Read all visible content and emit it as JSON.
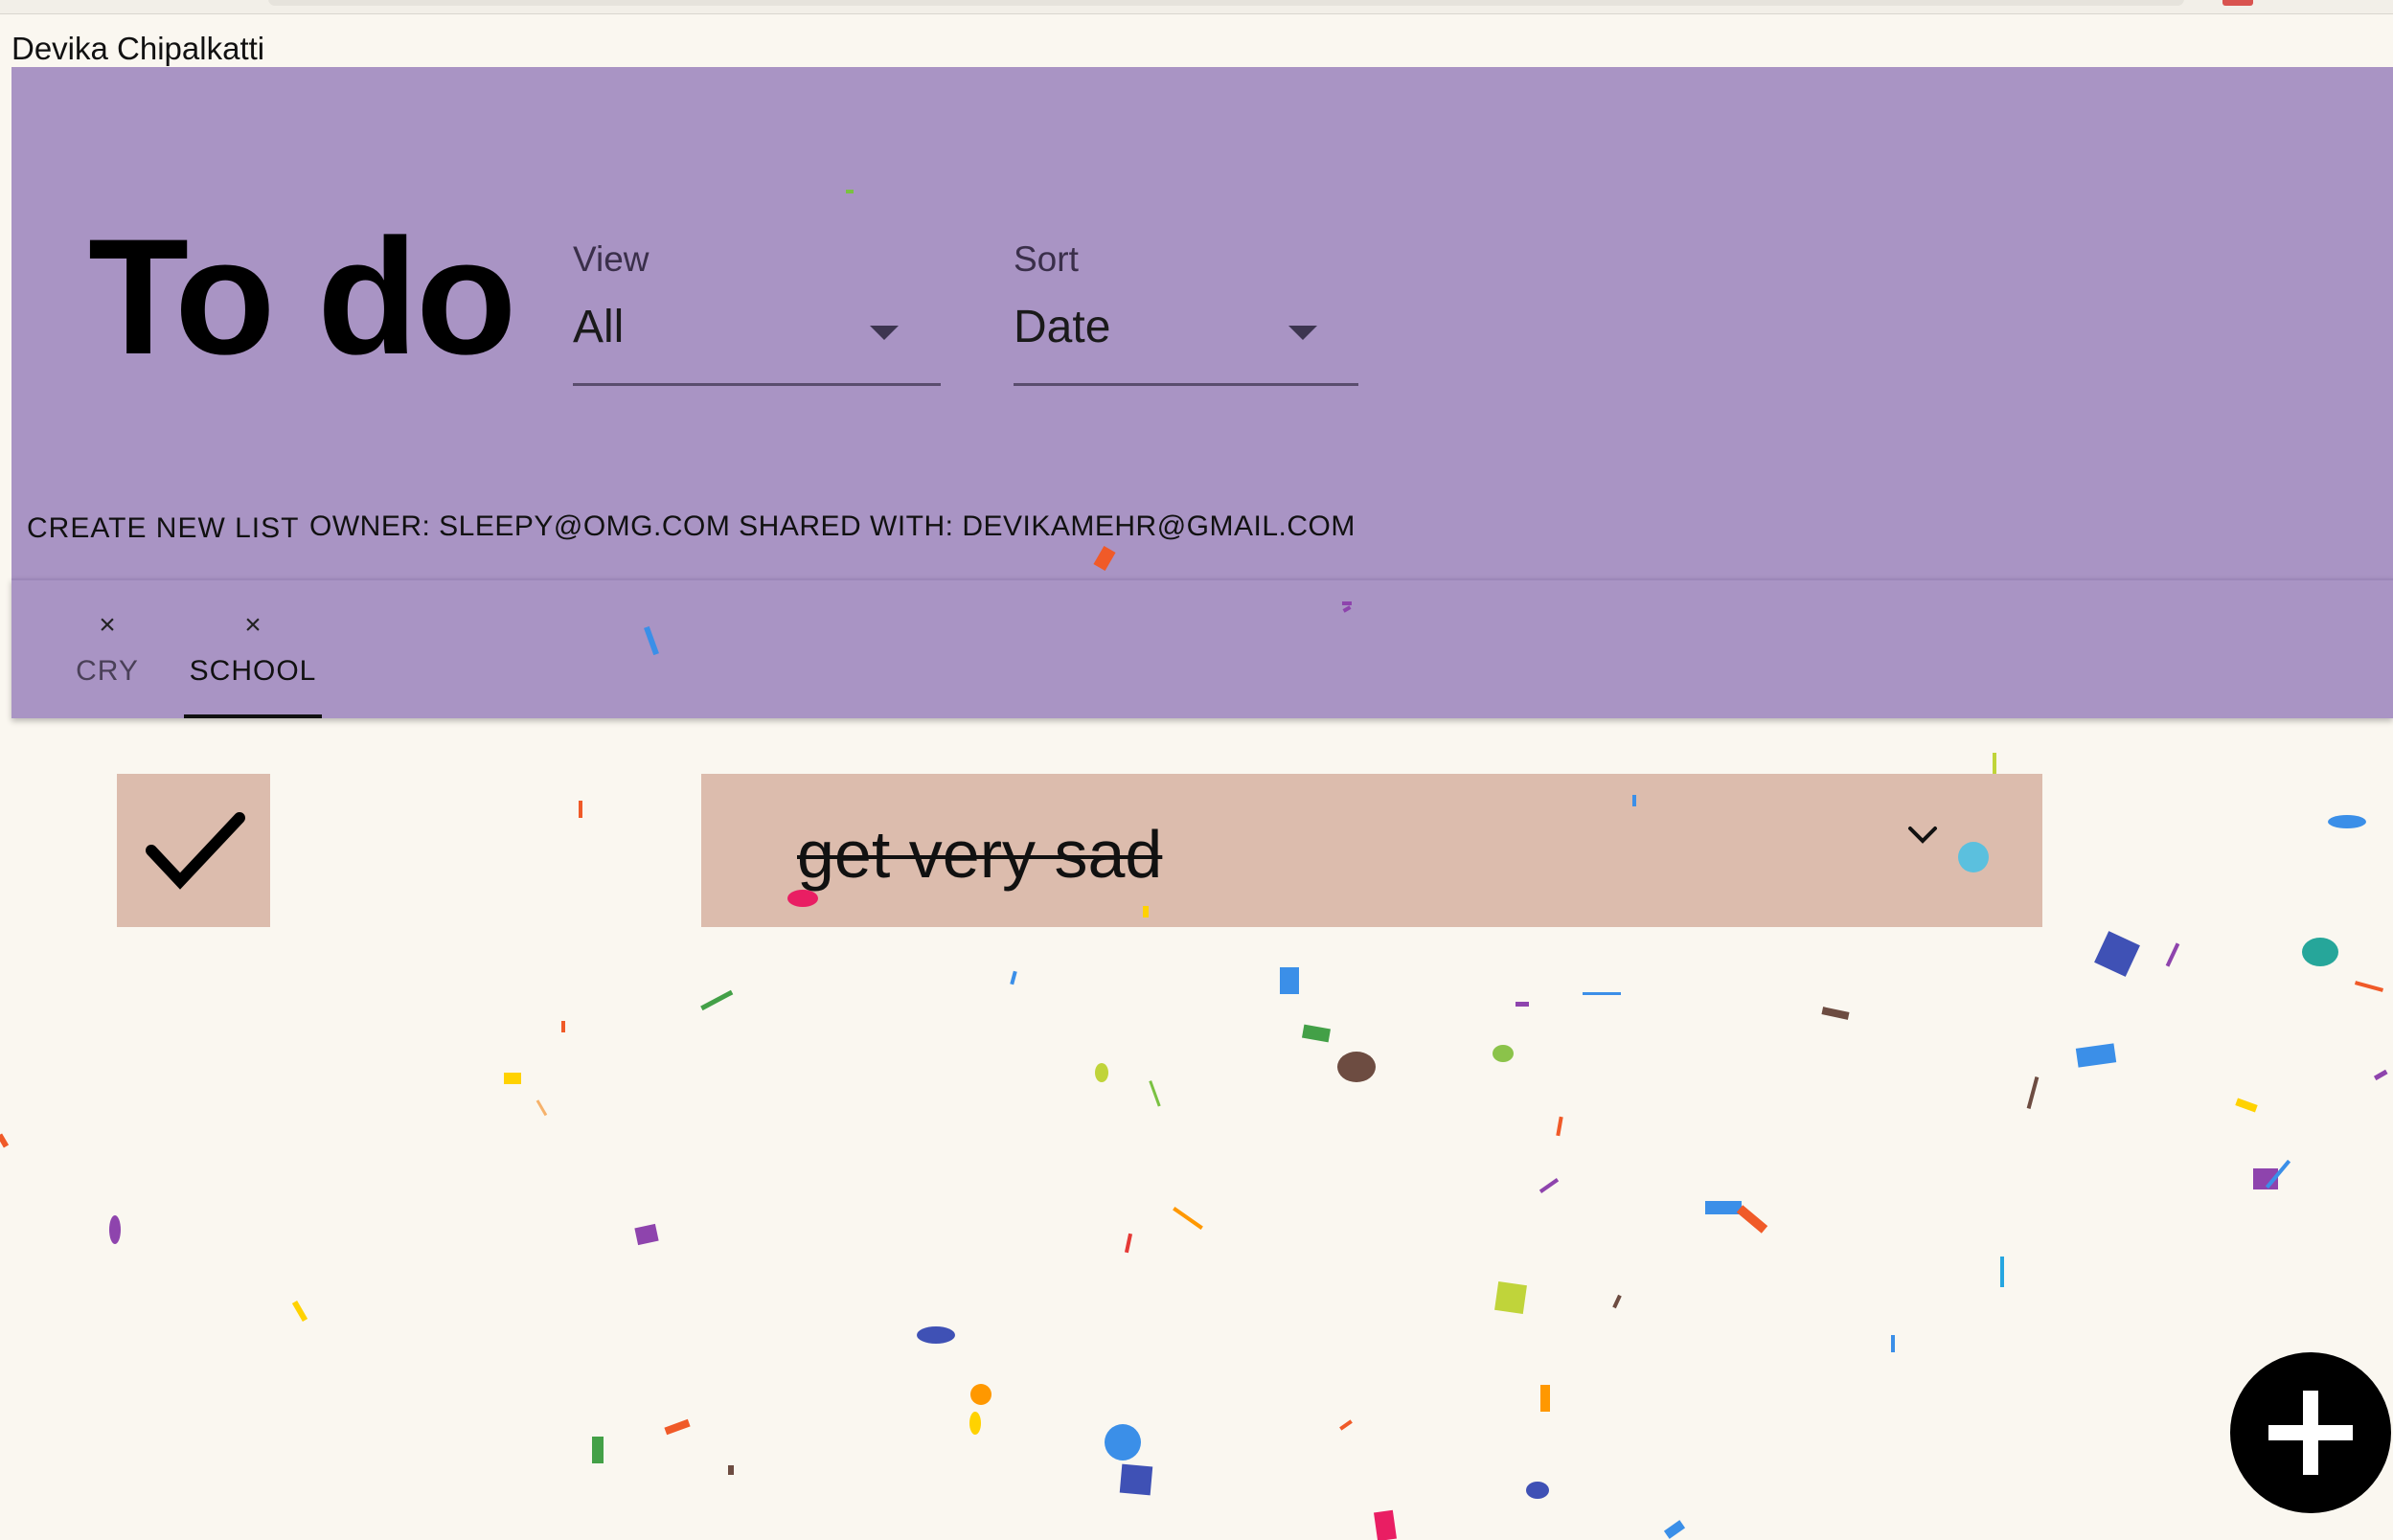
{
  "user": {
    "name": "Devika Chipalkatti"
  },
  "header": {
    "title": "To do",
    "view_select": {
      "label": "View",
      "value": "All"
    },
    "sort_select": {
      "label": "Sort",
      "value": "Date"
    },
    "create_list_label": "CREATE NEW LIST",
    "owner_info": "OWNER: SLEEPY@OMG.COM SHARED WITH: DEVIKAMEHR@GMAIL.COM"
  },
  "tabs": [
    {
      "label": "CRY",
      "close_glyph": "×",
      "selected": false
    },
    {
      "label": "SCHOOL",
      "close_glyph": "×",
      "selected": true
    }
  ],
  "tasks": [
    {
      "text": "get very sad",
      "completed": true
    }
  ],
  "icons": {
    "checkmark": "check-icon",
    "expand": "chevron-down-icon",
    "add": "plus-icon",
    "dropdown": "caret-down-icon"
  },
  "colors": {
    "header_bg": "#a994c4",
    "task_bg": "#dcbcad",
    "page_bg": "#faf7f0",
    "fab_bg": "#000000"
  }
}
